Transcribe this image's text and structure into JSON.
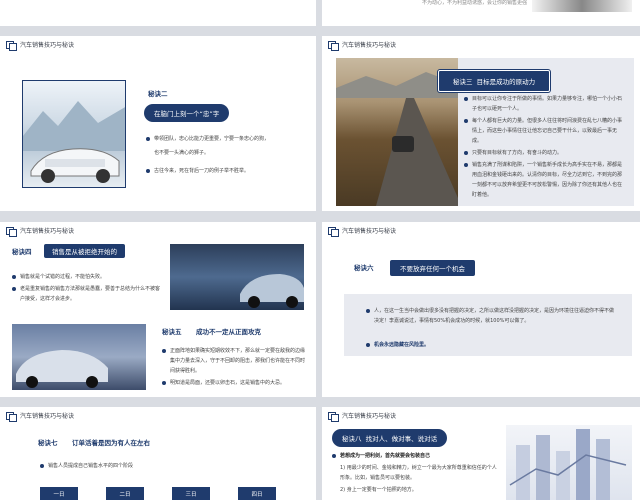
{
  "header_label": "汽车销售技巧与秘诀",
  "slide_top_left": {
    "title": ""
  },
  "slide_top_right": {
    "text": "不为动心，不为利益动诱惑，会让你的销售更强"
  },
  "slide_s2": {
    "title": "秘诀二",
    "subtitle": "在脑门上刻一个“忠”字",
    "bullets": [
      "带领团队，忠心比能力更重要，宁要一条忠心的狗，",
      "也不要一头满心的狮子。",
      "古往今来，死在背后一刀的例子举不胜举。"
    ]
  },
  "slide_s3": {
    "title": "秘诀三",
    "subtitle": "目标是成功的原动力",
    "bullets": [
      "目标可以让你专注于所做的事情。如果力量够专注，哪怕一个小小石子也可以砸死一个人。",
      "每个人都有巨大的力量。但很多人往往将时间浪费在乱七八糟的小事情上，而这些小事情往往让他忘记自己要干什么，以致最后一事无成。",
      "只要有目标就有了方向，有奋斗的动力。",
      "销售充满了刑谋和陷阱，一个销售新手成长为高手实在不易，那都是用血泪和金钱砸出来的。认清你的目标，尽全力达到它，不到完的那一刻都不可以放弃希望更不可放松警惕，因为除了你还有其他人也在盯着他。"
    ]
  },
  "slide_s4": {
    "title": "秘诀四",
    "subtitle": "销售是从被拒绝开始的",
    "bullets": [
      "销售就是个试错的过程，不能怕失败。",
      "老是重复销售的销售方法那就是愚蠢，要善于总结为什么不被客户接受，这样才会进步。"
    ]
  },
  "slide_s5": {
    "title": "秘诀五",
    "subtitle": "成功不一定从正面攻克",
    "bullets": [
      "正面阵地如果确实短期收效不下，那么就一定要在敌我的边缘集中力量去深入，守于不回卸的阻击，那我们也许能在不同时间获得胜利。",
      "明知道是局面，还要以卵击石，这是销售中的大忌。"
    ]
  },
  "slide_s6": {
    "title": "秘诀六",
    "subtitle": "不要放弃任何一个机会",
    "bullets": [
      "人，在这一生当中会做出很多没有把握的决定，之所以做这样没把握的决定，是因为环境往往逼迫你不得不做决定！李嘉诚说过，事情有50%机会成功的时候，就100%可以做了。",
      "机会永远隐藏在风险里。"
    ]
  },
  "slide_s7": {
    "title": "秘诀七",
    "subtitle": "订单活着是因为有人在左右",
    "bullets": [
      "销售人员提成自己销售水平的四个阶段"
    ],
    "stages": [
      "一日",
      "二日",
      "三日",
      "四日"
    ]
  },
  "slide_s8": {
    "title": "秘诀八",
    "subtitle": "找对人、做对事、说对话",
    "lead": "若想成为一把利剑，首先就要会包装自己",
    "items": [
      "1) 用最少的时间、金钱和精力，树立一个最为大家所尊重和信任的个人形象。比如，销售员可以要包装。",
      "2) 身上一定要有一个拍照的地方。"
    ]
  },
  "colors": {
    "accent": "#1f3b6d",
    "panel": "#e8eaf0"
  }
}
